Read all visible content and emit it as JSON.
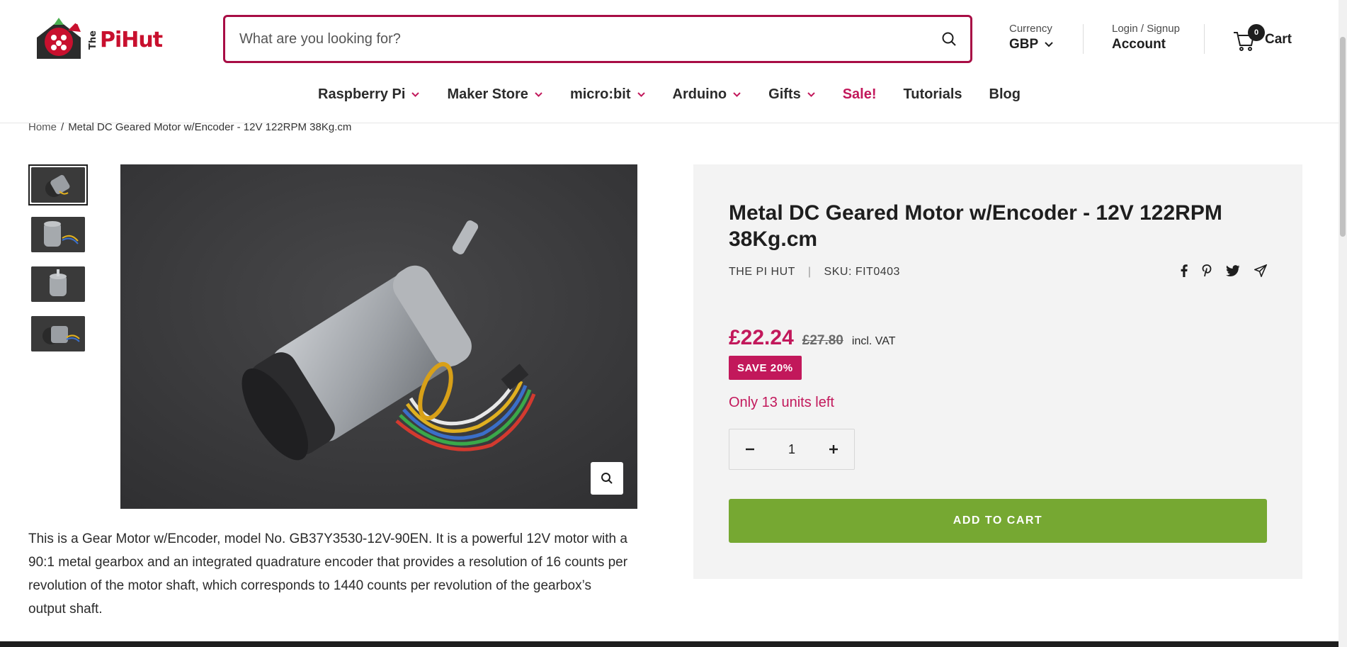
{
  "brand": {
    "logo_the": "The",
    "logo_word": "PiHut"
  },
  "search": {
    "placeholder": "What are you looking for?"
  },
  "header": {
    "currency_label": "Currency",
    "currency_value": "GBP",
    "account_label": "Login / Signup",
    "account_value": "Account",
    "cart_count": "0",
    "cart_label": "Cart"
  },
  "nav": [
    {
      "label": "Raspberry Pi",
      "dropdown": true
    },
    {
      "label": "Maker Store",
      "dropdown": true
    },
    {
      "label": "micro:bit",
      "dropdown": true
    },
    {
      "label": "Arduino",
      "dropdown": true
    },
    {
      "label": "Gifts",
      "dropdown": true
    },
    {
      "label": "Sale!",
      "dropdown": false
    },
    {
      "label": "Tutorials",
      "dropdown": false
    },
    {
      "label": "Blog",
      "dropdown": false
    }
  ],
  "breadcrumb": {
    "home": "Home",
    "separator": "/",
    "current": "Metal DC Geared Motor w/Encoder - 12V 122RPM 38Kg.cm"
  },
  "product": {
    "title": "Metal DC Geared Motor w/Encoder - 12V 122RPM 38Kg.cm",
    "vendor": "THE PI HUT",
    "sku": "SKU: FIT0403",
    "price": "£22.24",
    "compare_price": "£27.80",
    "vat_note": "incl. VAT",
    "save_badge": "SAVE 20%",
    "stock": "Only 13 units left",
    "quantity": "1",
    "add_to_cart": "ADD TO CART",
    "description": "This is a Gear Motor w/Encoder, model No. GB37Y3530-12V-90EN. It is a powerful 12V motor with a 90:1 metal gearbox and an integrated quadrature encoder that provides a resolution of 16 counts per revolution of the motor shaft, which corresponds to 1440 counts per revolution of the gearbox’s output shaft."
  },
  "colors": {
    "accent": "#c2185b",
    "search_border": "#a80d45",
    "add_to_cart": "#76a832",
    "panel_bg": "#f3f3f3"
  },
  "icons": [
    "search-icon",
    "chevron-down-icon",
    "cart-icon",
    "zoom-icon",
    "facebook-icon",
    "pinterest-icon",
    "twitter-icon",
    "send-icon",
    "minus-icon",
    "plus-icon"
  ]
}
